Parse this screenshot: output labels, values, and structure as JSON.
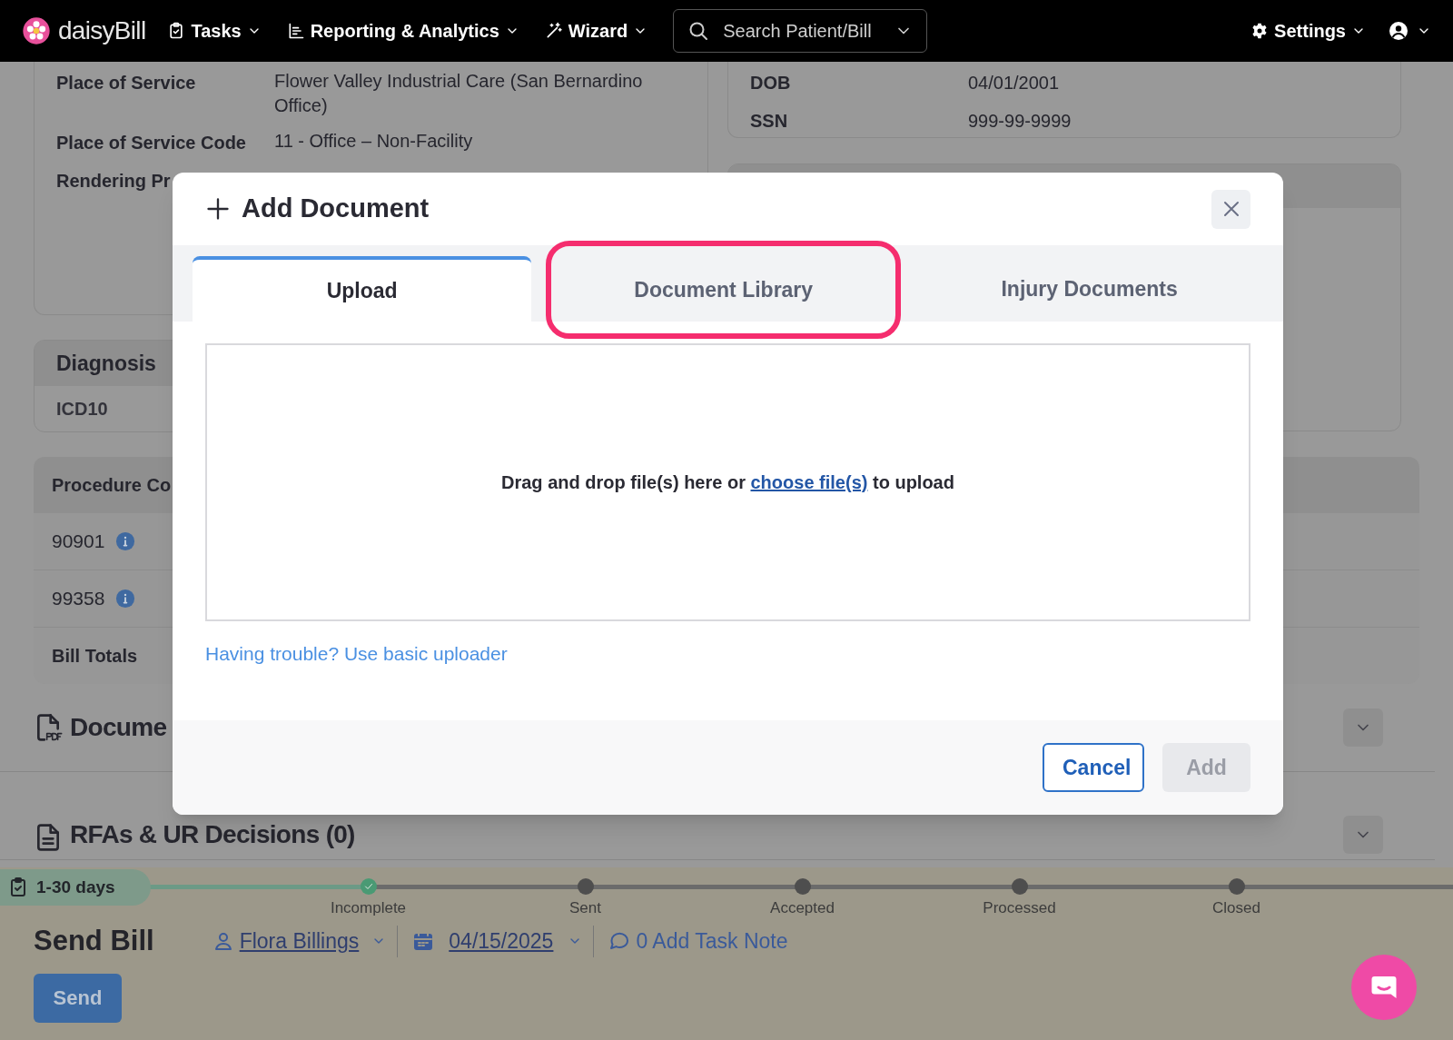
{
  "nav": {
    "logo": "daisyBill",
    "menus": [
      {
        "label": "Tasks"
      },
      {
        "label": "Reporting & Analytics"
      },
      {
        "label": "Wizard"
      }
    ],
    "search": {
      "placeholder": "Search Patient/Bill"
    },
    "settings": "Settings"
  },
  "bill_info": {
    "rows": [
      {
        "label": "Place of Service",
        "value": "Flower Valley Industrial Care (San Bernardino Office)"
      },
      {
        "label": "Place of Service Code",
        "value": "11 - Office – Non-Facility"
      },
      {
        "label": "Rendering Pr"
      }
    ]
  },
  "patient_info": {
    "rows": [
      {
        "label": "DOB",
        "value": "04/01/2001"
      },
      {
        "label": "SSN",
        "value": "999-99-9999"
      }
    ]
  },
  "diagnosis": {
    "title": "Diagnosis",
    "rows": [
      "ICD10"
    ]
  },
  "procedures": {
    "header": "Procedure Co",
    "rows": [
      {
        "code": "90901"
      },
      {
        "code": "99358"
      }
    ],
    "totals": "Bill Totals"
  },
  "sections": [
    {
      "title": "Docume",
      "kind": "pdf"
    },
    {
      "title": "RFAs & UR Decisions (0)",
      "kind": "doc"
    }
  ],
  "timeline": {
    "badge": "1-30 days",
    "steps": [
      {
        "label": "Incomplete",
        "done": true
      },
      {
        "label": "Sent",
        "done": false
      },
      {
        "label": "Accepted",
        "done": false
      },
      {
        "label": "Processed",
        "done": false
      },
      {
        "label": "Closed",
        "done": false
      }
    ]
  },
  "task": {
    "title": "Send Bill",
    "assignee": "Flora Billings",
    "date": "04/15/2025",
    "note": "0 Add Task Note",
    "button": "Send"
  },
  "modal": {
    "title": "Add Document",
    "tabs": [
      {
        "label": "Upload",
        "selected": true,
        "highlighted": false
      },
      {
        "label": "Document Library",
        "selected": false,
        "highlighted": true
      },
      {
        "label": "Injury Documents",
        "selected": false,
        "highlighted": false
      }
    ],
    "dropzone": {
      "before": "Drag and drop file(s) here or ",
      "link": "choose file(s)",
      "after": " to upload"
    },
    "help_link": "Having trouble? Use basic uploader",
    "buttons": [
      {
        "label": "Cancel",
        "disabled": false
      },
      {
        "label": "Add",
        "disabled": true
      }
    ]
  }
}
